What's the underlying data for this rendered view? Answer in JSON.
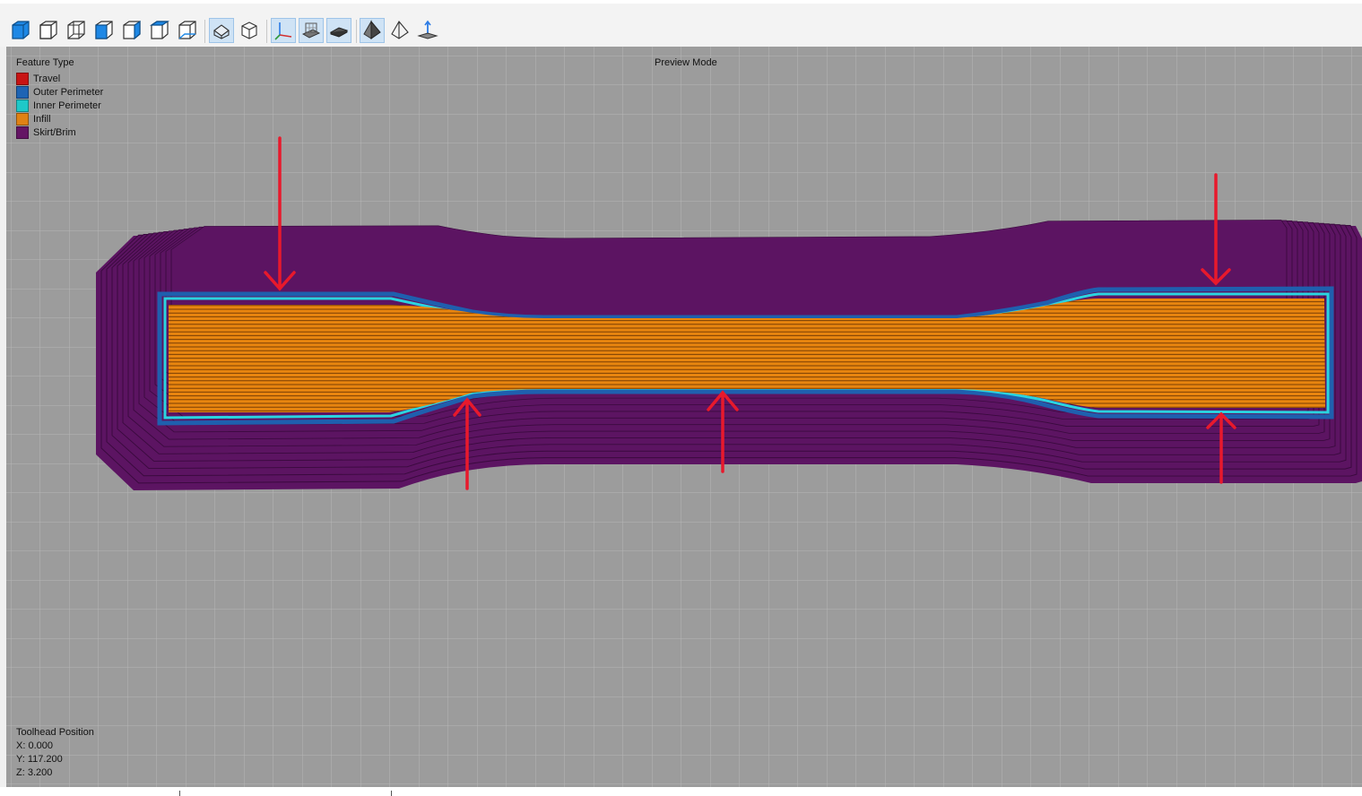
{
  "toolbar": {
    "buttons": [
      {
        "icon": "solid-cube-view-icon"
      },
      {
        "icon": "front-view-icon"
      },
      {
        "icon": "back-view-icon"
      },
      {
        "icon": "left-view-icon"
      },
      {
        "icon": "right-view-icon"
      },
      {
        "icon": "top-view-icon"
      },
      {
        "icon": "bottom-view-icon"
      },
      {
        "icon": "perspective-projection-icon",
        "active": true
      },
      {
        "icon": "orthographic-projection-icon"
      },
      {
        "icon": "axes-toggle-icon",
        "active": true
      },
      {
        "icon": "bed-toggle-icon",
        "active": true
      },
      {
        "icon": "shadow-toggle-icon",
        "active": true
      },
      {
        "icon": "solid-shading-icon",
        "active": true
      },
      {
        "icon": "wireframe-shading-icon"
      },
      {
        "icon": "toolhead-position-icon"
      }
    ]
  },
  "viewport": {
    "mode_label": "Preview Mode",
    "legend": {
      "title": "Feature Type",
      "items": [
        {
          "label": "Travel",
          "color": "#c81414"
        },
        {
          "label": "Outer Perimeter",
          "color": "#1e64b4"
        },
        {
          "label": "Inner Perimeter",
          "color": "#1ec8c8"
        },
        {
          "label": "Infill",
          "color": "#e08214"
        },
        {
          "label": "Skirt/Brim",
          "color": "#641464"
        }
      ]
    },
    "toolhead": {
      "title": "Toolhead Position",
      "x": "X: 0.000",
      "y": "Y: 117.200",
      "z": "Z: 3.200"
    },
    "colors": {
      "background": "#9c9c9c",
      "grid": "#b6b6b6",
      "skirt": "#5c1462",
      "outer_perimeter": "#1f5fae",
      "inner_perimeter": "#2ad4e0",
      "infill": "#e8850f",
      "annotation_arrow": "#e8192c"
    }
  }
}
